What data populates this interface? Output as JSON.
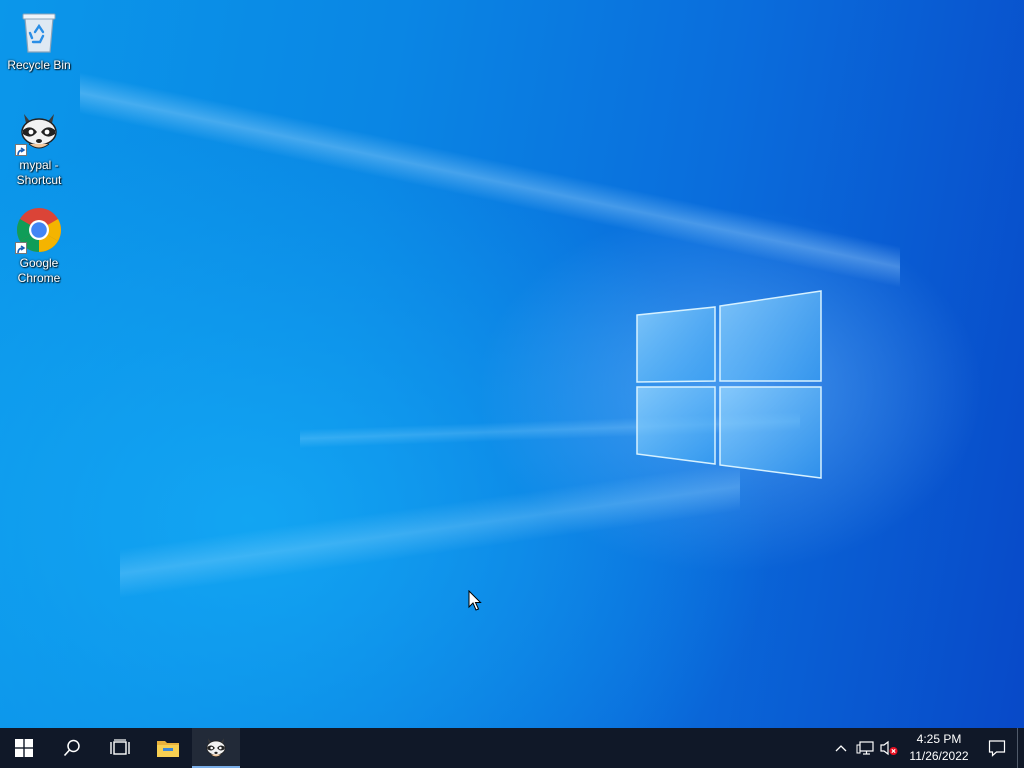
{
  "desktop": {
    "icons": [
      {
        "label": "Recycle Bin",
        "icon": "recycle-bin-icon"
      },
      {
        "label": "mypal - Shortcut",
        "icon": "mypal-raccoon-icon"
      },
      {
        "label": "Google Chrome",
        "icon": "chrome-icon"
      }
    ],
    "wallpaper": {
      "primary": "#0a86e4",
      "dark": "#0849c8",
      "glow": "#9fd6ff"
    }
  },
  "taskbar": {
    "items": [
      {
        "name": "start-button",
        "icon": "windows-logo-icon"
      },
      {
        "name": "search-button",
        "icon": "search-icon"
      },
      {
        "name": "task-view-button",
        "icon": "task-view-icon"
      },
      {
        "name": "file-explorer-button",
        "icon": "folder-icon"
      },
      {
        "name": "mypal-taskbar-button",
        "icon": "mypal-raccoon-icon",
        "running": true
      }
    ],
    "tray": {
      "overflow_icon": "chevron-up-icon",
      "network_icon": "network-icon",
      "volume_icon": "volume-muted-icon",
      "time": "4:25 PM",
      "date": "11/26/2022",
      "notification_icon": "notification-icon"
    },
    "background": "#101828",
    "accent": "#7aaee8"
  }
}
